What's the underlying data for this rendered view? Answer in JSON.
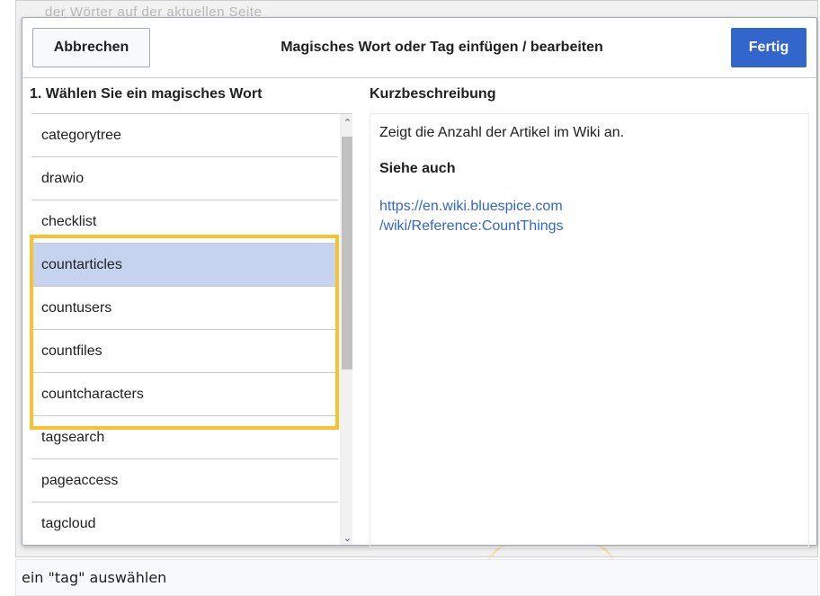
{
  "background": {
    "partial_text": "der Wörter auf der aktuellen Seite"
  },
  "dialog": {
    "cancel_label": "Abbrechen",
    "title": "Magisches Wort oder Tag einfügen / bearbeiten",
    "done_label": "Fertig"
  },
  "list_panel": {
    "heading": "1. Wählen Sie ein magisches Wort",
    "items": [
      {
        "label": "categorytree",
        "selected": false
      },
      {
        "label": "drawio",
        "selected": false
      },
      {
        "label": "checklist",
        "selected": false
      },
      {
        "label": "countarticles",
        "selected": true
      },
      {
        "label": "countusers",
        "selected": false
      },
      {
        "label": "countfiles",
        "selected": false
      },
      {
        "label": "countcharacters",
        "selected": false
      },
      {
        "label": "tagsearch",
        "selected": false
      },
      {
        "label": "pageaccess",
        "selected": false
      },
      {
        "label": "tagcloud",
        "selected": false
      }
    ]
  },
  "description_panel": {
    "heading": "Kurzbeschreibung",
    "text": "Zeigt die Anzahl der Artikel im Wiki an.",
    "see_also": "Siehe auch",
    "link_line1": "https://en.wiki.bluespice.com",
    "link_line2": "/wiki/Reference:CountThings"
  },
  "caption": "ein \"tag\" auswählen",
  "colors": {
    "primary": "#3366cc",
    "selected_row": "#c5d3ef",
    "highlight_border": "#fbc02d"
  }
}
